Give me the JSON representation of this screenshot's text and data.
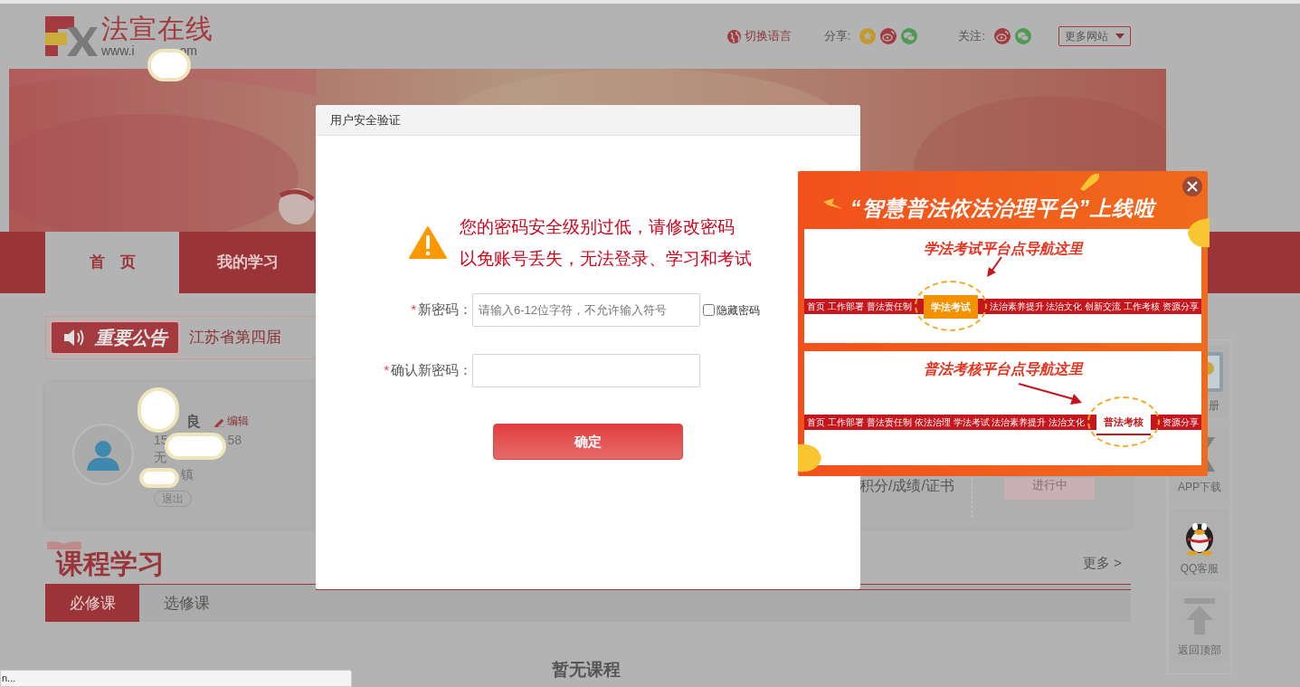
{
  "header": {
    "logo_title": "法宣在线",
    "logo_url_start": "www.i",
    "logo_url_end": "om",
    "language": "切换语言",
    "share_label": "分享:",
    "follow_label": "关注:",
    "more_sites": "更多网站"
  },
  "nav": [
    {
      "label": "首　页",
      "selected": true
    },
    {
      "label": "我的学习",
      "selected": false
    }
  ],
  "notice": {
    "badge": "重要公告",
    "text": "江苏省第四届"
  },
  "profile": {
    "name": "良",
    "edit": "编辑",
    "phone_start": "15",
    "phone_end": "58",
    "line_2": "无",
    "line_3": "镇",
    "logout": "退出",
    "stat": "积分/成绩/证书",
    "status": "进行中"
  },
  "courses": {
    "title": "课程学习",
    "more": "更多 >",
    "tabs": [
      {
        "label": "必修课",
        "selected": true
      },
      {
        "label": "选修课",
        "selected": false
      }
    ],
    "empty": "暂无课程"
  },
  "sidebar": [
    {
      "kind": "manual",
      "label": "册"
    },
    {
      "kind": "app",
      "label": "APP下载"
    },
    {
      "kind": "qq",
      "label": "QQ客服"
    },
    {
      "kind": "top",
      "label": "返回顶部"
    }
  ],
  "status_bar": "n...",
  "modal": {
    "title": "用户安全验证",
    "warning_lines": [
      "您的密码安全级别过低，请修改密码",
      "以免账号丢失，无法登录、学习和考试"
    ],
    "fields": [
      {
        "label": "新密码：",
        "marker": "*",
        "placeholder": "请输入6-12位字符，不允许输入符号",
        "checkbox": {
          "label": "隐藏密码",
          "checked": false
        }
      },
      {
        "label": "确认新密码：",
        "marker": "*"
      }
    ],
    "submit": "确定"
  },
  "promo": {
    "title": "“智慧普法依法治理平台”上线啦",
    "panels": [
      {
        "heading": "学法考试平台点导航这里",
        "nav": [
          {
            "label": "首页",
            "highlighted": false
          },
          {
            "label": "工作部署",
            "highlighted": false
          },
          {
            "label": "普法责任制",
            "highlighted": false
          },
          {
            "label": "学法考试",
            "highlighted": true
          },
          {
            "label": "法治素养提升",
            "highlighted": false
          },
          {
            "label": "法治文化",
            "highlighted": false
          },
          {
            "label": "创新交流",
            "highlighted": false
          },
          {
            "label": "工作考核",
            "highlighted": false
          },
          {
            "label": "资源分享",
            "highlighted": false
          }
        ]
      },
      {
        "heading": "普法考核平台点导航这里",
        "nav": [
          {
            "label": "首页",
            "highlighted": false
          },
          {
            "label": "工作部署",
            "highlighted": false
          },
          {
            "label": "普法责任制",
            "highlighted": false
          },
          {
            "label": "依法治理",
            "highlighted": false
          },
          {
            "label": "学法考试",
            "highlighted": false
          },
          {
            "label": "法治素养提升",
            "highlighted": false
          },
          {
            "label": "法治文化",
            "highlighted": false
          },
          {
            "label": "普法考核",
            "highlighted": true
          },
          {
            "label": "资源分享",
            "highlighted": false
          }
        ]
      }
    ]
  }
}
